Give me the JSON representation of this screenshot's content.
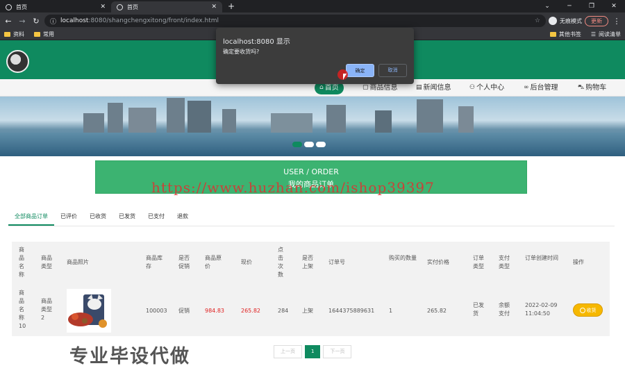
{
  "browser": {
    "tabs": [
      {
        "title": "首页"
      },
      {
        "title": "首页"
      }
    ],
    "address": {
      "host": "localhost",
      "rest": ":8080/shangchengxitong/front/index.html"
    },
    "incognito_label": "无痕模式",
    "update_label": "更新",
    "bookmarks_left": [
      "资料",
      "常用"
    ],
    "bookmarks_right": [
      "其他书签",
      "阅读清单"
    ]
  },
  "nav": {
    "items": [
      {
        "label": "首页",
        "icon": "home-icon"
      },
      {
        "label": "商品信息",
        "icon": "document-icon"
      },
      {
        "label": "新闻信息",
        "icon": "news-icon"
      },
      {
        "label": "个人中心",
        "icon": "user-icon"
      },
      {
        "label": "后台管理",
        "icon": "link-icon"
      },
      {
        "label": "购物车",
        "icon": "cart-icon"
      }
    ]
  },
  "page": {
    "title_en": "USER / ORDER",
    "title_zh": "我的商品订单",
    "watermark_url": "https://www.huzhan.com/ishop39397",
    "watermark_text": "专业毕设代做"
  },
  "sub_tabs": [
    "全部商品订单",
    "已评价",
    "已收货",
    "已发货",
    "已支付",
    "退款"
  ],
  "table": {
    "headers": [
      "商品名称",
      "商品类型",
      "商品照片",
      "商品库存",
      "是否促销",
      "商品原价",
      "现价",
      "点击次数",
      "是否上架",
      "订单号",
      "购买的数量",
      "实付价格",
      "订单类型",
      "支付类型",
      "订单创建时间",
      "操作"
    ],
    "row": {
      "name": "商品名称10",
      "type": "商品类型2",
      "stock": "100003",
      "promo": "促销",
      "orig_price": "984.83",
      "price": "265.82",
      "clicks": "284",
      "on_shelf": "上架",
      "order_no": "1644375889631",
      "qty": "1",
      "paid": "265.82",
      "order_type": "已发货",
      "pay_type": "余额支付",
      "created": "2022-02-09 11:04:50",
      "action": "收货"
    }
  },
  "pager": {
    "prev": "上一页",
    "current": "1",
    "next": "下一页"
  },
  "dialog": {
    "title": "localhost:8080 显示",
    "message": "确定要收货吗?",
    "ok": "确定",
    "cancel": "取消"
  },
  "colors": {
    "brand": "#0f8a5f",
    "title_box": "#3cb371",
    "price_red": "#e02020",
    "action_btn": "#f6b800"
  }
}
